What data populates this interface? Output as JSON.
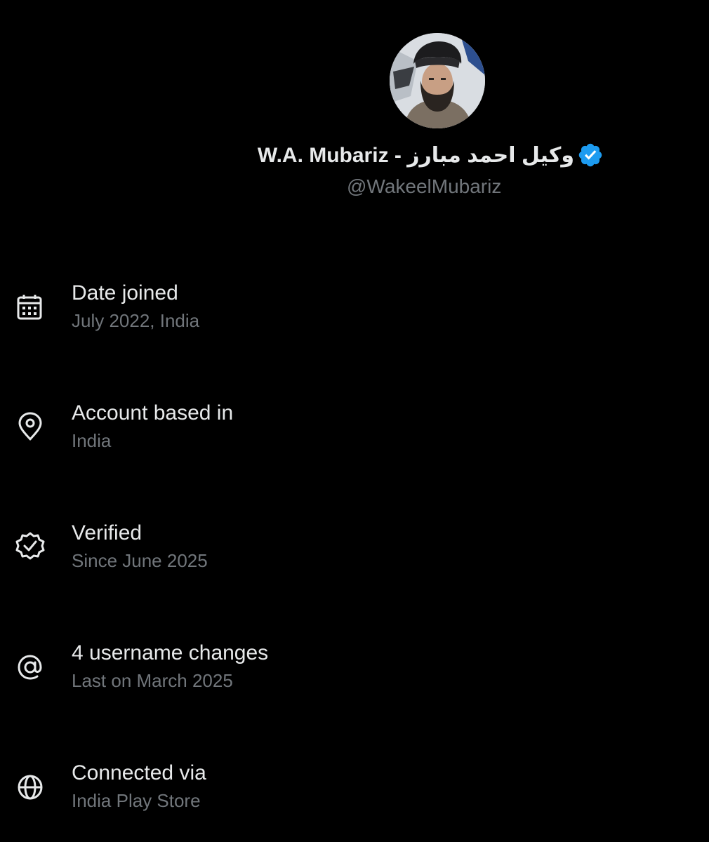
{
  "profile": {
    "display_name": "W.A. Mubariz - وکیل احمد مبارز",
    "handle": "@WakeelMubariz",
    "verified_badge_color": "#1d9bf0",
    "avatar": "profile-photo"
  },
  "info": [
    {
      "icon": "calendar-icon",
      "title": "Date joined",
      "subtitle": "July 2022, India"
    },
    {
      "icon": "location-pin-icon",
      "title": "Account based in",
      "subtitle": "India"
    },
    {
      "icon": "verified-check-icon",
      "title": "Verified",
      "subtitle": "Since June 2025"
    },
    {
      "icon": "at-sign-icon",
      "title": "4 username changes",
      "subtitle": "Last on March 2025"
    },
    {
      "icon": "globe-icon",
      "title": "Connected via",
      "subtitle": "India Play Store"
    }
  ],
  "colors": {
    "background": "#000000",
    "primary_text": "#e7e9ea",
    "secondary_text": "#71767b",
    "accent": "#1d9bf0"
  }
}
